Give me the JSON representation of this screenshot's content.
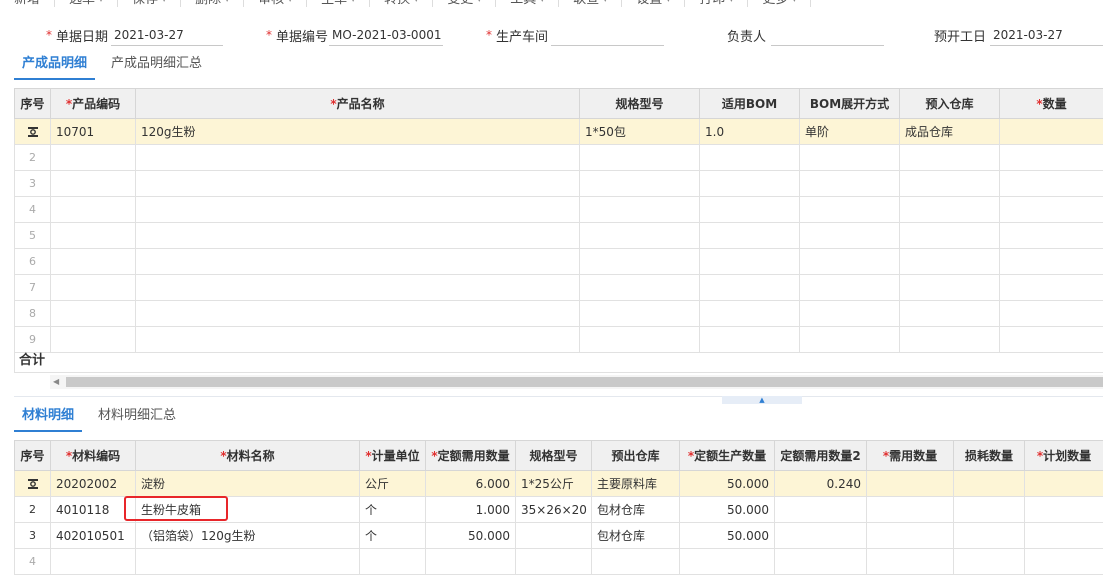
{
  "toolbar": {
    "items": [
      "新增",
      "选单",
      "保存",
      "删除",
      "审核",
      "生单",
      "转换",
      "变更",
      "工具",
      "联查",
      "设置",
      "打印",
      "更多"
    ]
  },
  "header_fields": {
    "date_label": "单据日期",
    "date_value": "2021-03-27",
    "number_label": "单据编号",
    "number_value": "MO-2021-03-0001",
    "workshop_label": "生产车间",
    "workshop_value": "",
    "owner_label": "负责人",
    "owner_value": "",
    "start_label": "预开工日",
    "start_value": "2021-03-27"
  },
  "product_tabs": [
    "产成品明细",
    "产成品明细汇总"
  ],
  "product_table": {
    "headers": [
      "序号",
      "产品编码",
      "产品名称",
      "规格型号",
      "适用BOM",
      "BOM展开方式",
      "预入仓库",
      "数量"
    ],
    "rows": [
      {
        "seq": "",
        "code": "10701",
        "name": "120g生粉",
        "spec": "1*50包",
        "bom": "1.0",
        "mode": "单阶",
        "warehouse": "成品仓库",
        "qty": ""
      },
      {
        "seq": "2"
      },
      {
        "seq": "3"
      },
      {
        "seq": "4"
      },
      {
        "seq": "5"
      },
      {
        "seq": "6"
      },
      {
        "seq": "7"
      },
      {
        "seq": "8"
      },
      {
        "seq": "9"
      }
    ],
    "total_label": "合计"
  },
  "material_tabs": [
    "材料明细",
    "材料明细汇总"
  ],
  "material_table": {
    "headers": [
      "序号",
      "材料编码",
      "材料名称",
      "计量单位",
      "定额需用数量",
      "规格型号",
      "预出仓库",
      "定额生产数量",
      "定额需用数量2",
      "需用数量",
      "损耗数量",
      "计划数量"
    ],
    "rows": [
      {
        "seq": "",
        "code": "20202002",
        "name": "淀粉",
        "unit": "公斤",
        "quota": "6.000",
        "spec": "1*25公斤",
        "warehouse": "主要原料库",
        "prod": "50.000",
        "quota2": "0.240",
        "need": "",
        "loss": "",
        "plan": ""
      },
      {
        "seq": "2",
        "code": "4010118",
        "name": "生粉牛皮箱",
        "unit": "个",
        "quota": "1.000",
        "spec": "35×26×20",
        "warehouse": "包材仓库",
        "prod": "50.000",
        "quota2": "",
        "need": "",
        "loss": "",
        "plan": ""
      },
      {
        "seq": "3",
        "code": "402010501",
        "name": "（铝箔袋）120g生粉",
        "unit": "个",
        "quota": "50.000",
        "spec": "",
        "warehouse": "包材仓库",
        "prod": "50.000",
        "quota2": "",
        "need": "",
        "loss": "",
        "plan": ""
      },
      {
        "seq": "4"
      }
    ]
  },
  "colors": {
    "accent": "#2f7fd3",
    "required": "#e03030",
    "selected_row": "#fdf5d6",
    "highlight_box": "#e8262a"
  }
}
